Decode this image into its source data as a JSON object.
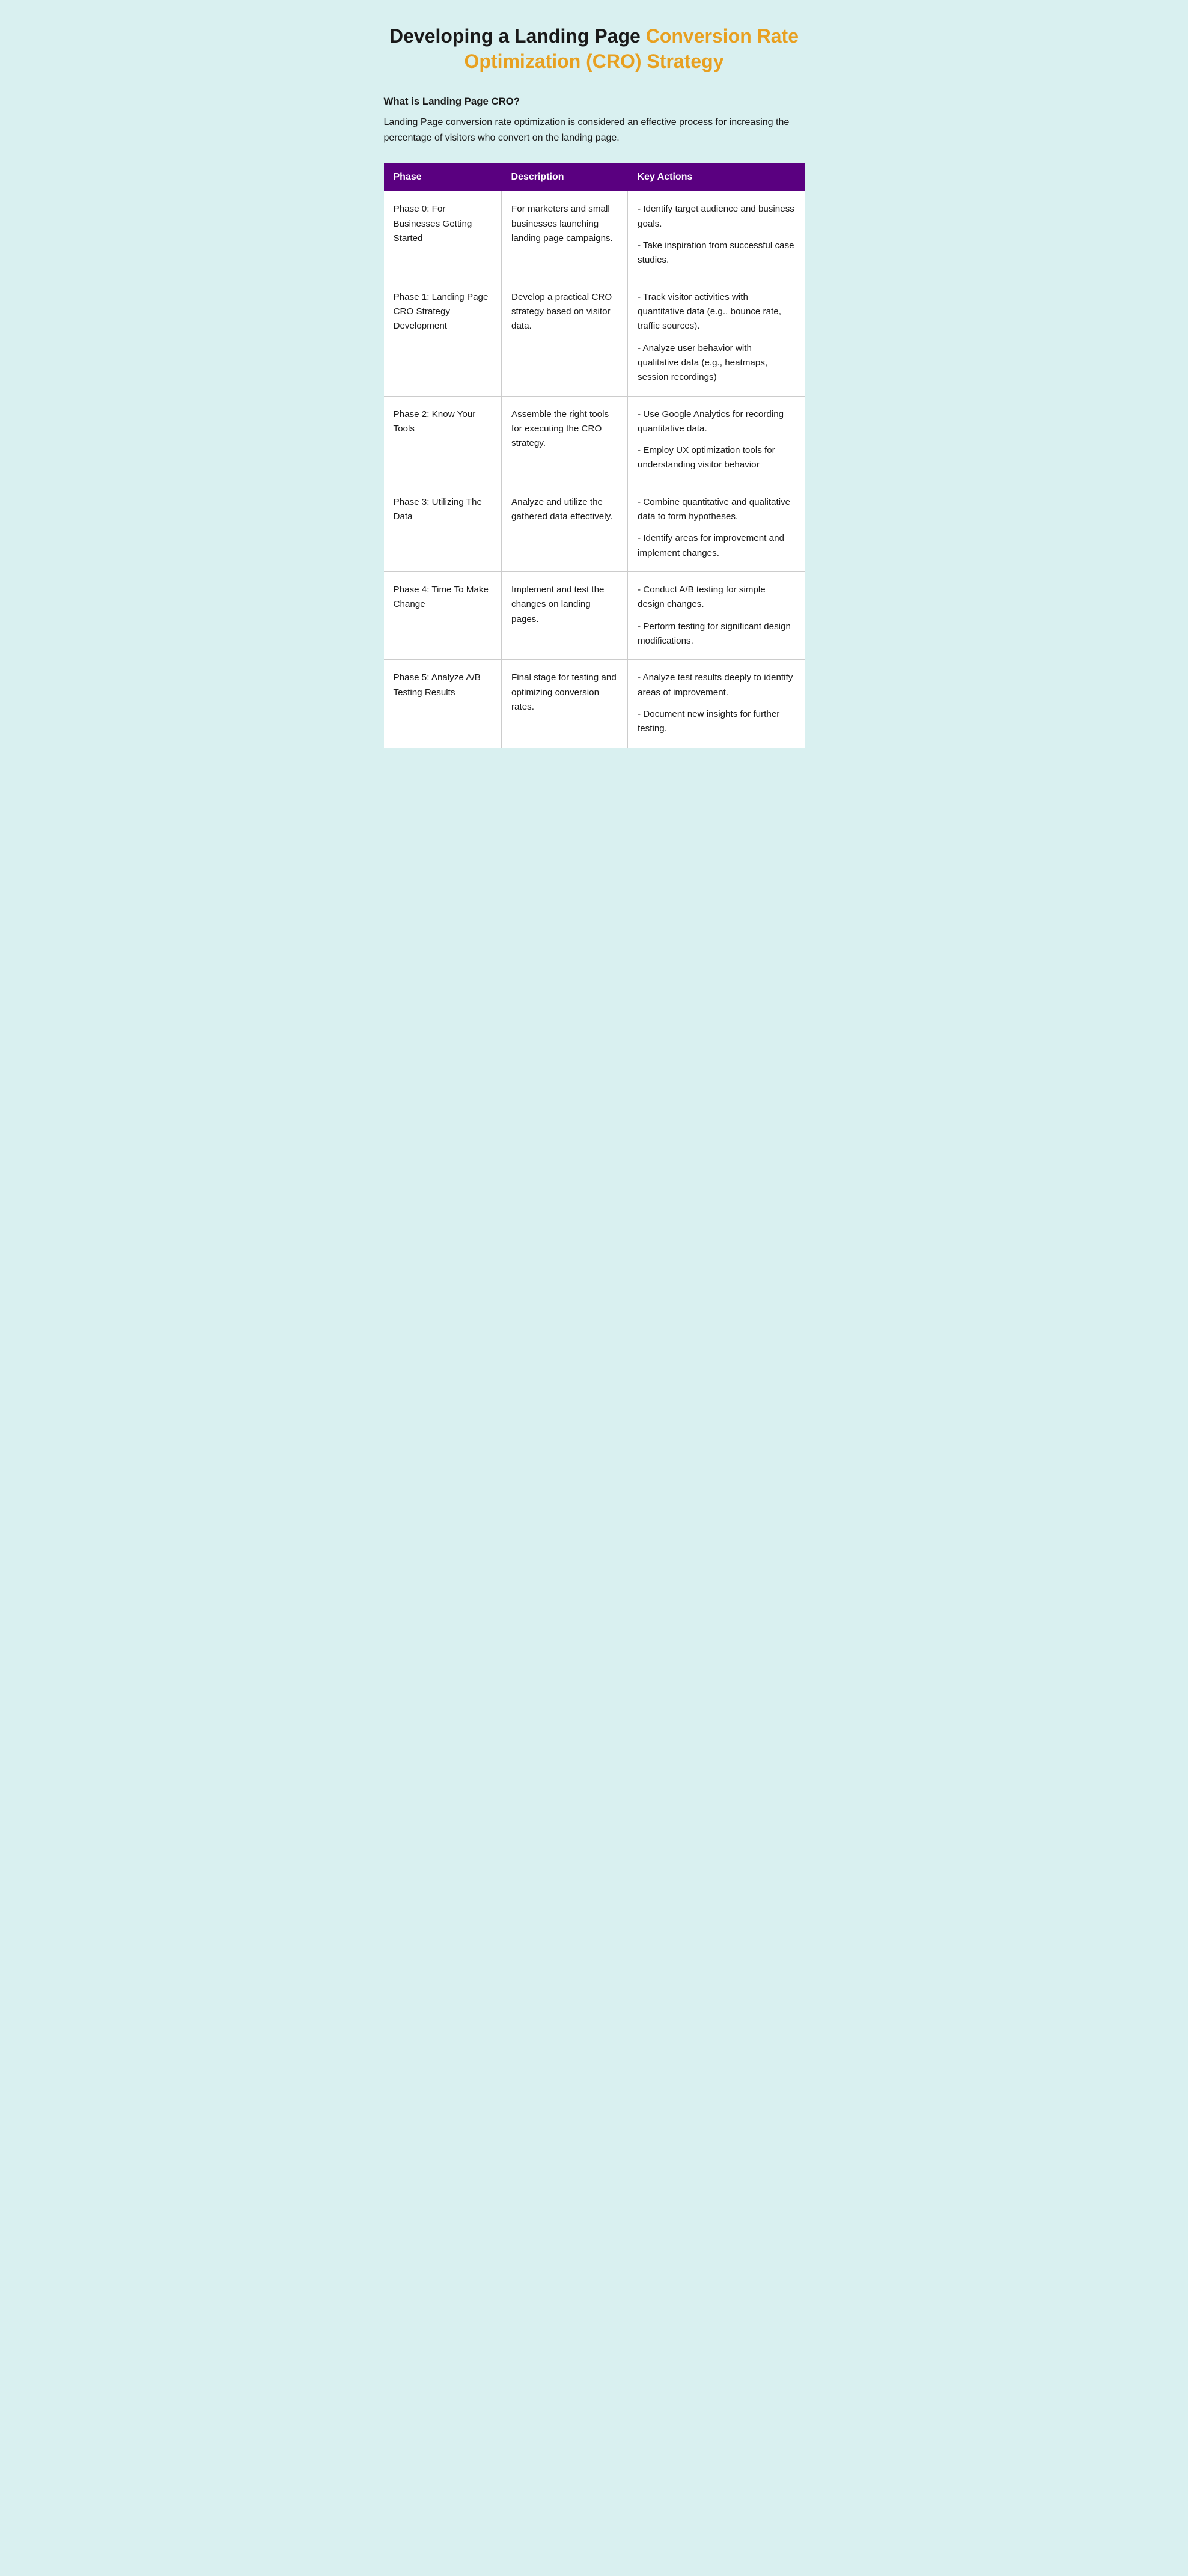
{
  "title": {
    "part1": "Developing a Landing Page ",
    "part2": "Conversion Rate Optimization (CRO) Strategy"
  },
  "what_is": {
    "heading": "What is Landing Page CRO?",
    "body": "Landing Page conversion rate optimization is considered an effective process for increasing the percentage of visitors who convert on the landing page."
  },
  "table": {
    "headers": [
      "Phase",
      "Description",
      "Key Actions"
    ],
    "rows": [
      {
        "phase": "Phase 0: For Businesses Getting Started",
        "description": "For marketers and small businesses launching landing page campaigns.",
        "key_actions": "- Identify target audience and business goals.\n\n- Take inspiration from successful case studies."
      },
      {
        "phase": "Phase 1: Landing Page CRO Strategy Development",
        "description": "Develop a practical CRO strategy based on visitor data.",
        "key_actions": "- Track visitor activities with quantitative data (e.g., bounce rate, traffic sources).\n\n- Analyze user behavior with qualitative data (e.g., heatmaps, session recordings)"
      },
      {
        "phase": "Phase 2: Know Your Tools",
        "description": "Assemble the right tools for executing the CRO strategy.",
        "key_actions": "- Use Google Analytics for recording quantitative data.\n\n- Employ UX optimization tools for understanding visitor behavior"
      },
      {
        "phase": "Phase 3: Utilizing The Data",
        "description": "Analyze and utilize the gathered data effectively.",
        "key_actions": "- Combine quantitative and qualitative data to form hypotheses.\n\n- Identify areas for improvement and implement changes."
      },
      {
        "phase": "Phase 4: Time To Make Change",
        "description": "Implement and test the changes on landing pages.",
        "key_actions": "- Conduct A/B testing for simple design changes.\n\n - Perform testing for significant design modifications."
      },
      {
        "phase": "Phase 5: Analyze A/B Testing Results",
        "description": "Final stage for testing and optimizing conversion rates.",
        "key_actions": "- Analyze test results deeply to identify areas of improvement.\n\n- Document new insights for further testing."
      }
    ]
  }
}
